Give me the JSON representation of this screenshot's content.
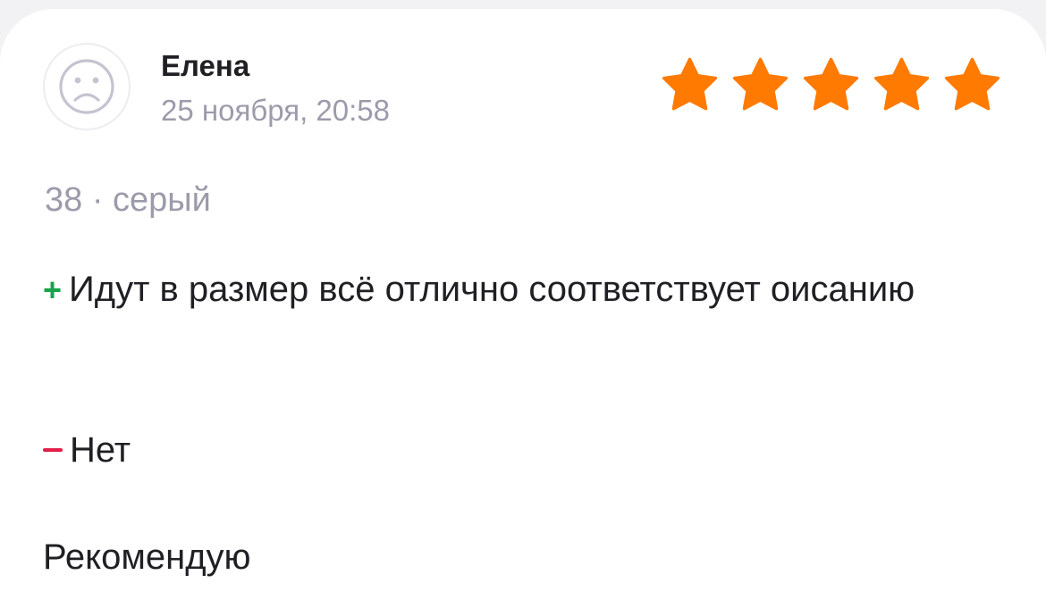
{
  "review": {
    "author_name": "Елена",
    "date": "25 ноября, 20:58",
    "avatar_icon": "sad-face-icon",
    "rating": 5,
    "rating_max": 5,
    "star_color": "#ff7a00",
    "variant": "38 · серый",
    "pros_marker": "+",
    "pros_text": "Идут в размер всё отлично соответствует оисанию",
    "cons_text": "Нет",
    "comment": "Рекомендую",
    "pros_marker_color": "#16a34a",
    "cons_marker_color": "#e11d48"
  }
}
